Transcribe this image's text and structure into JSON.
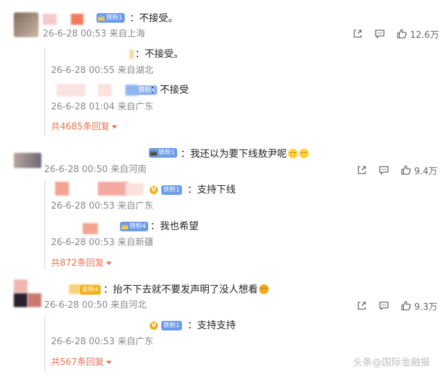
{
  "comments": [
    {
      "text": "：不接受。",
      "badge": "铁粉1",
      "meta": "26-6-28 00:53 来自上海",
      "likes": "12.6万",
      "replies": [
        {
          "text": "：不接受。",
          "meta": "26-6-28 00:55 来自湖北"
        },
        {
          "text": "：不接受",
          "badge": "铁粉1",
          "meta": "26-6-28 01:04 来自广东"
        }
      ],
      "more": "共4685条回复"
    },
    {
      "text": "：我还以为要下线敖尹呢",
      "badge": "铁粉1",
      "meta": "26-6-28 00:50 来自河南",
      "likes": "9.4万",
      "replies": [
        {
          "text": "：支持下线",
          "badge": "铁粉1",
          "vip": "V",
          "meta": "26-6-28 00:53 来自广东"
        },
        {
          "text": "：我也希望",
          "badge": "铁粉4",
          "meta": "26-6-28 00:53 来自新疆"
        }
      ],
      "more": "共872条回复"
    },
    {
      "text": "：抬不下去就不要发声明了没人想看",
      "badge": "金粉4",
      "meta": "26-6-28 00:50 来自河北",
      "likes": "9.3万",
      "replies": [
        {
          "text": "：支持支持",
          "badge": "铁粉1",
          "vip": "V",
          "meta": "26-6-28 00:53 来自广东"
        }
      ],
      "more": "共567条回复"
    }
  ],
  "icons": {
    "share": "share-icon",
    "comment": "comment-icon",
    "like": "thumbs-up-icon"
  },
  "colors": {
    "accent": "#eb7350",
    "badge_blue": "#6b9bea",
    "badge_gold": "#f2b01e"
  },
  "watermark": "头条@国际金融报"
}
